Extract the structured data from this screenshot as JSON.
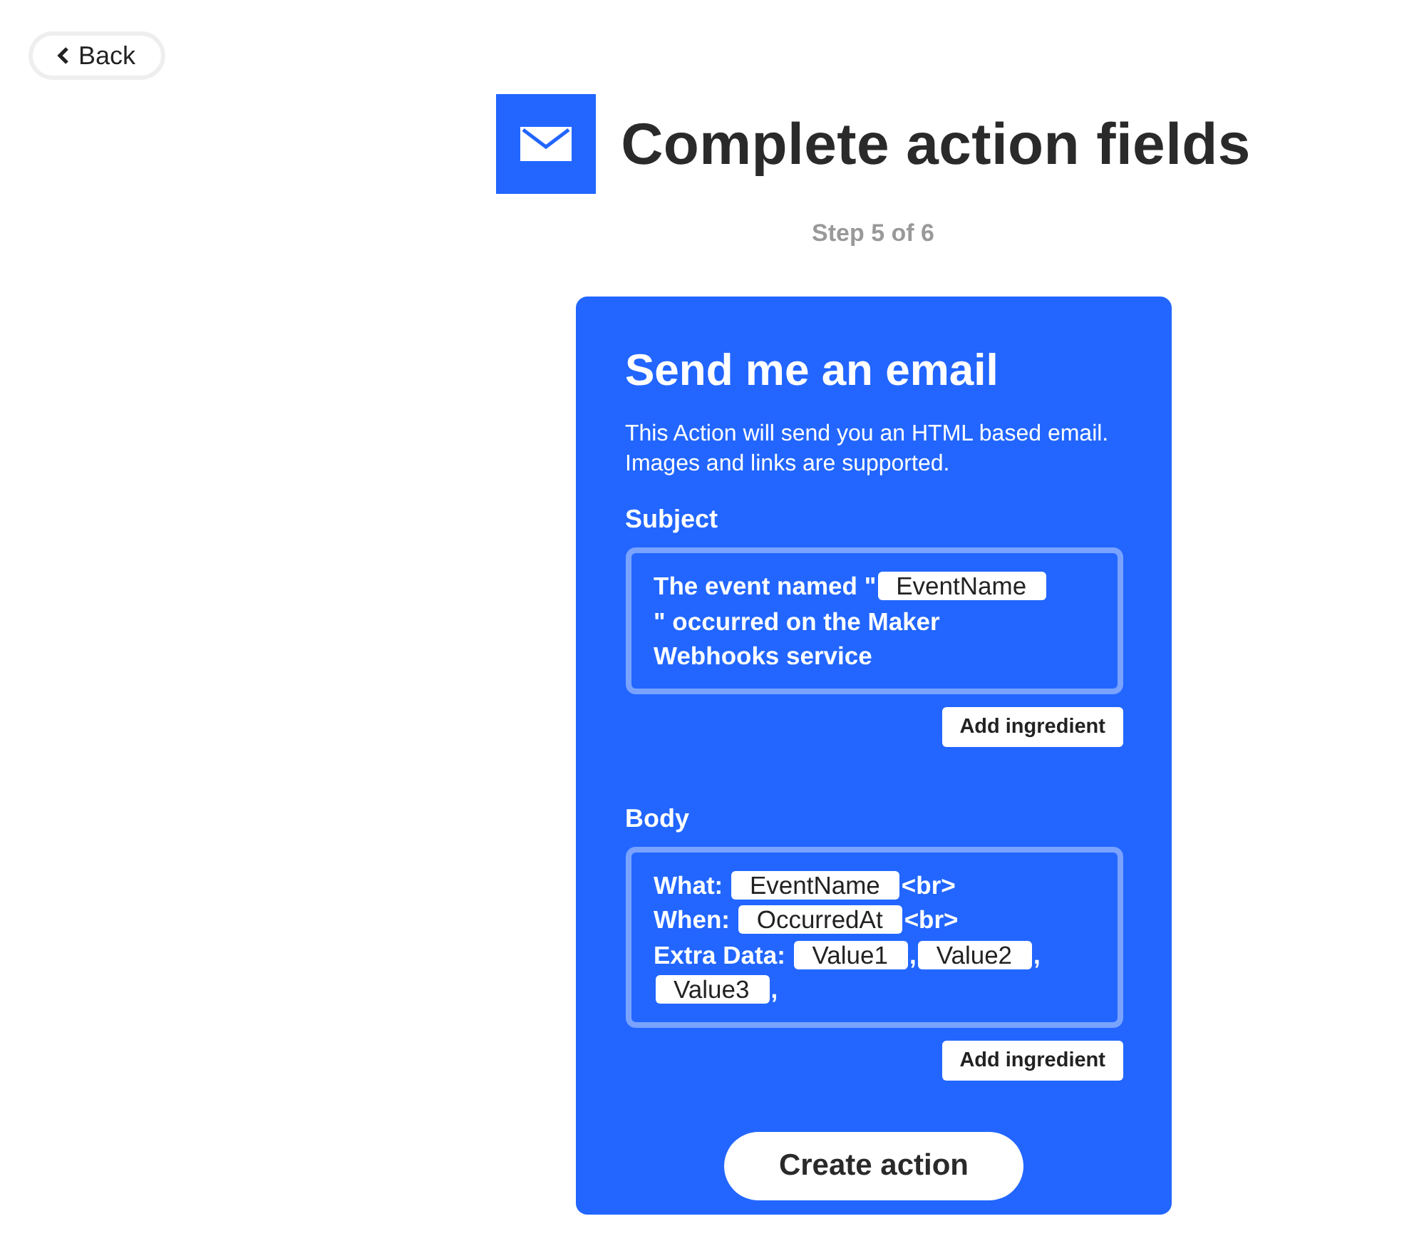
{
  "back_button": {
    "label": "Back"
  },
  "header": {
    "title": "Complete action fields",
    "step": "Step 5 of 6"
  },
  "card": {
    "title": "Send me an email",
    "description": "This Action will send you an HTML based email. Images and links are supported.",
    "fields": [
      {
        "label": "Subject",
        "add_button": "Add ingredient",
        "segments": [
          {
            "kind": "text",
            "text": "The event named \""
          },
          {
            "kind": "ingredient",
            "text": "EventName"
          },
          {
            "kind": "break"
          },
          {
            "kind": "text",
            "text": "\" occurred on the Maker"
          },
          {
            "kind": "break"
          },
          {
            "kind": "text",
            "text": "Webhooks service"
          }
        ]
      },
      {
        "label": "Body",
        "add_button": "Add ingredient",
        "segments": [
          {
            "kind": "text",
            "text": "What: "
          },
          {
            "kind": "ingredient",
            "text": "EventName"
          },
          {
            "kind": "text",
            "text": "<br>"
          },
          {
            "kind": "break"
          },
          {
            "kind": "text",
            "text": "When: "
          },
          {
            "kind": "ingredient",
            "text": "OccurredAt"
          },
          {
            "kind": "text",
            "text": "<br>"
          },
          {
            "kind": "break"
          },
          {
            "kind": "text",
            "text": "Extra Data: "
          },
          {
            "kind": "ingredient",
            "text": "Value1"
          },
          {
            "kind": "text",
            "text": ","
          },
          {
            "kind": "ingredient",
            "text": "Value2"
          },
          {
            "kind": "text",
            "text": ","
          },
          {
            "kind": "break"
          },
          {
            "kind": "ingredient",
            "text": "Value3"
          },
          {
            "kind": "text",
            "text": ","
          }
        ]
      }
    ],
    "submit": "Create action"
  }
}
